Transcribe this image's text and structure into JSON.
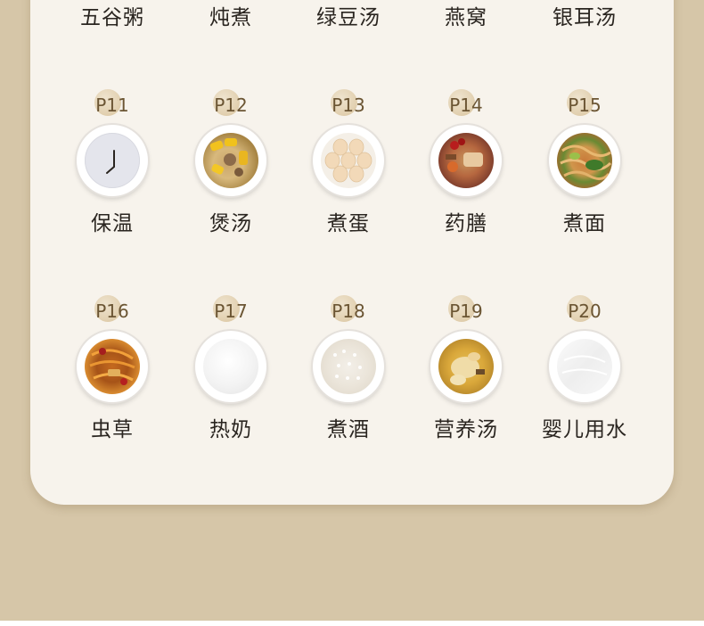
{
  "top_labels": [
    "五谷粥",
    "炖煮",
    "绿豆汤",
    "燕窝",
    "银耳汤"
  ],
  "rows": [
    [
      {
        "code": "P11",
        "name": "保温",
        "food": "clock-icon"
      },
      {
        "code": "P12",
        "name": "煲汤",
        "food": "corn-soup-image"
      },
      {
        "code": "P13",
        "name": "煮蛋",
        "food": "boiled-eggs-image"
      },
      {
        "code": "P14",
        "name": "药膳",
        "food": "herbal-dish-image"
      },
      {
        "code": "P15",
        "name": "煮面",
        "food": "noodles-image"
      }
    ],
    [
      {
        "code": "P16",
        "name": "虫草",
        "food": "cordyceps-image"
      },
      {
        "code": "P17",
        "name": "热奶",
        "food": "hot-milk-image"
      },
      {
        "code": "P18",
        "name": "煮酒",
        "food": "rice-wine-image"
      },
      {
        "code": "P19",
        "name": "营养汤",
        "food": "chicken-soup-image"
      },
      {
        "code": "P20",
        "name": "婴儿用水",
        "food": "baby-water-image"
      }
    ]
  ]
}
